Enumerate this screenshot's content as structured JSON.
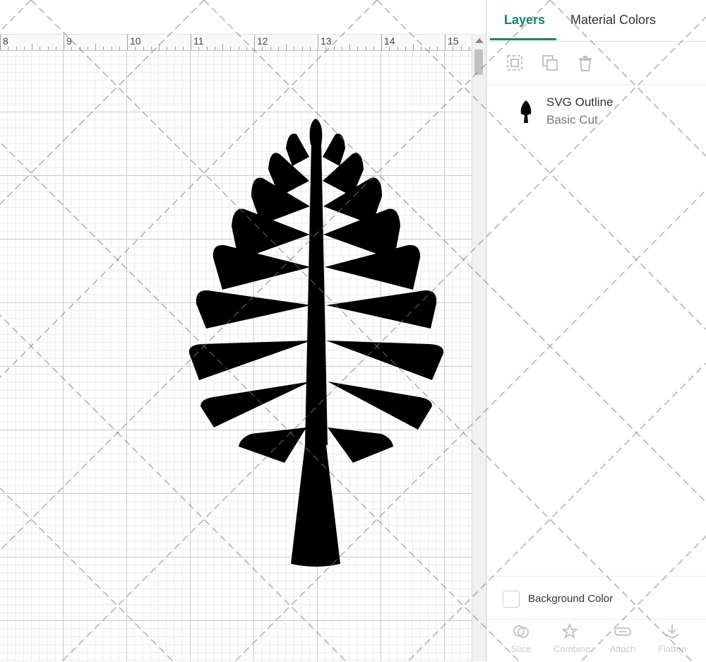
{
  "ruler": {
    "labels": [
      "8",
      "9",
      "10",
      "11",
      "12",
      "13",
      "14",
      "15"
    ]
  },
  "panel": {
    "tabs": [
      {
        "label": "Layers",
        "active": true
      },
      {
        "label": "Material Colors",
        "active": false
      }
    ],
    "toolbar": {
      "icons": [
        "group-icon",
        "duplicate-icon",
        "delete-icon"
      ]
    },
    "layers": [
      {
        "name": "SVG Outline",
        "type": "Basic Cut"
      }
    ],
    "background": {
      "label": "Background Color",
      "checked": false
    },
    "bottom_tools": [
      {
        "label": "Slice",
        "icon": "slice-icon"
      },
      {
        "label": "Combine",
        "icon": "combine-icon"
      },
      {
        "label": "Attach",
        "icon": "attach-icon"
      },
      {
        "label": "Flatten",
        "icon": "flatten-icon"
      }
    ]
  },
  "colors": {
    "accent": "#0f8a6a",
    "shape": "#000000",
    "grid_major": "#c9c9c9",
    "grid_minor": "#e9e9e9"
  }
}
